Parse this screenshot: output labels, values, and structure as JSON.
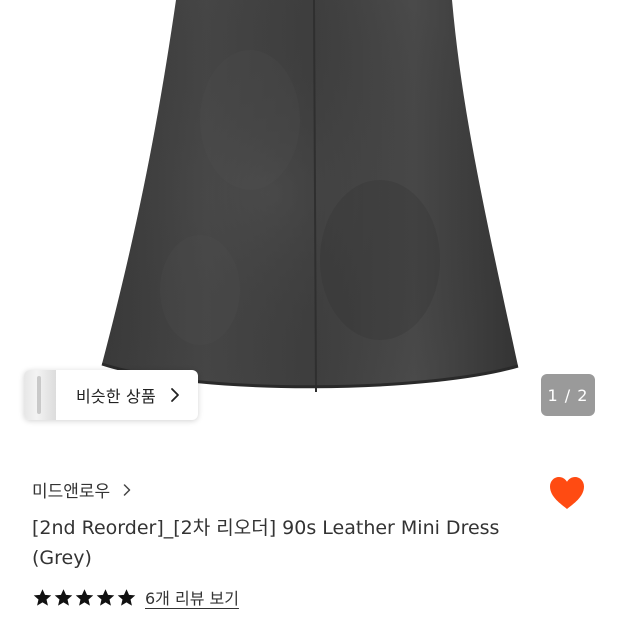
{
  "product_image": {
    "alt_icon": "dress-image",
    "pager": {
      "current": "1",
      "total": "2",
      "text": "1 / 2"
    }
  },
  "similar_products": {
    "label": "비슷한 상품",
    "icon": "chevron-right-icon"
  },
  "brand": {
    "name": "미드앤로우",
    "icon": "chevron-right-icon"
  },
  "wishlist": {
    "icon": "heart-icon",
    "active": true,
    "color": "#ff4b12"
  },
  "product": {
    "title": "[2nd Reorder]_[2차 리오더] 90s Leather Mini Dress (Grey)"
  },
  "rating": {
    "stars": 5,
    "max": 5,
    "icon": "star-icon",
    "review_link": "6개 리뷰 보기"
  }
}
